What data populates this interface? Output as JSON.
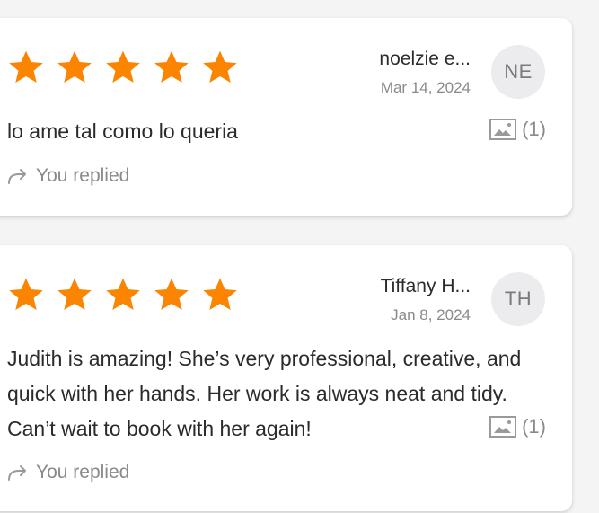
{
  "colors": {
    "star": "#fb8500",
    "text": "#2b2b2b",
    "muted": "#8a8a8a",
    "avatar_bg": "#ececee"
  },
  "icons": {
    "star": "star-icon",
    "photo": "image-icon",
    "reply": "reply-arrow-icon"
  },
  "reviews": [
    {
      "rating": 5,
      "reviewer_name": "noelzie e...",
      "date": "Mar 14, 2024",
      "initials": "NE",
      "text": "lo ame tal como lo queria",
      "photo_count": "(1)",
      "reply_status": "You replied"
    },
    {
      "rating": 5,
      "reviewer_name": "Tiffany H...",
      "date": "Jan 8, 2024",
      "initials": "TH",
      "text": "Judith is amazing! She’s very professional, creative, and quick with her hands. Her work is always neat and tidy. Can’t wait to book with her again!",
      "photo_count": "(1)",
      "reply_status": "You replied"
    }
  ]
}
